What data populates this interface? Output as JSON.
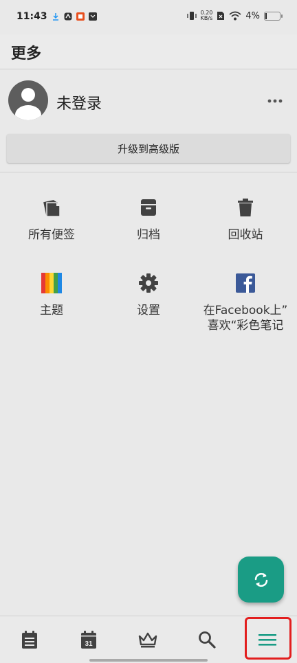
{
  "status_bar": {
    "time": "11:43",
    "net_speed_value": "0.20",
    "net_speed_unit": "KB/s",
    "battery": "4%"
  },
  "header": {
    "title": "更多"
  },
  "profile": {
    "name": "未登录"
  },
  "upgrade_button": {
    "label": "升级到高级版"
  },
  "grid": [
    {
      "label": "所有便签",
      "icon": "notes-icon"
    },
    {
      "label": "归档",
      "icon": "archive-icon"
    },
    {
      "label": "回收站",
      "icon": "trash-icon"
    },
    {
      "label": "主题",
      "icon": "theme-palette-icon"
    },
    {
      "label": "设置",
      "icon": "gear-icon"
    },
    {
      "label_line1": "在Facebook上”",
      "label_line2": "喜欢“彩色笔记",
      "icon": "facebook-icon"
    }
  ],
  "bottom_nav": [
    {
      "name": "notes",
      "icon": "notes-list-icon"
    },
    {
      "name": "calendar",
      "icon": "calendar-icon",
      "day": "31"
    },
    {
      "name": "premium",
      "icon": "crown-icon"
    },
    {
      "name": "search",
      "icon": "search-icon"
    },
    {
      "name": "more",
      "icon": "menu-icon",
      "active": true
    }
  ],
  "colors": {
    "background": "#e9e9e9",
    "accent": "#1a9c85",
    "icon": "#424242",
    "highlight": "#e21e1e"
  }
}
